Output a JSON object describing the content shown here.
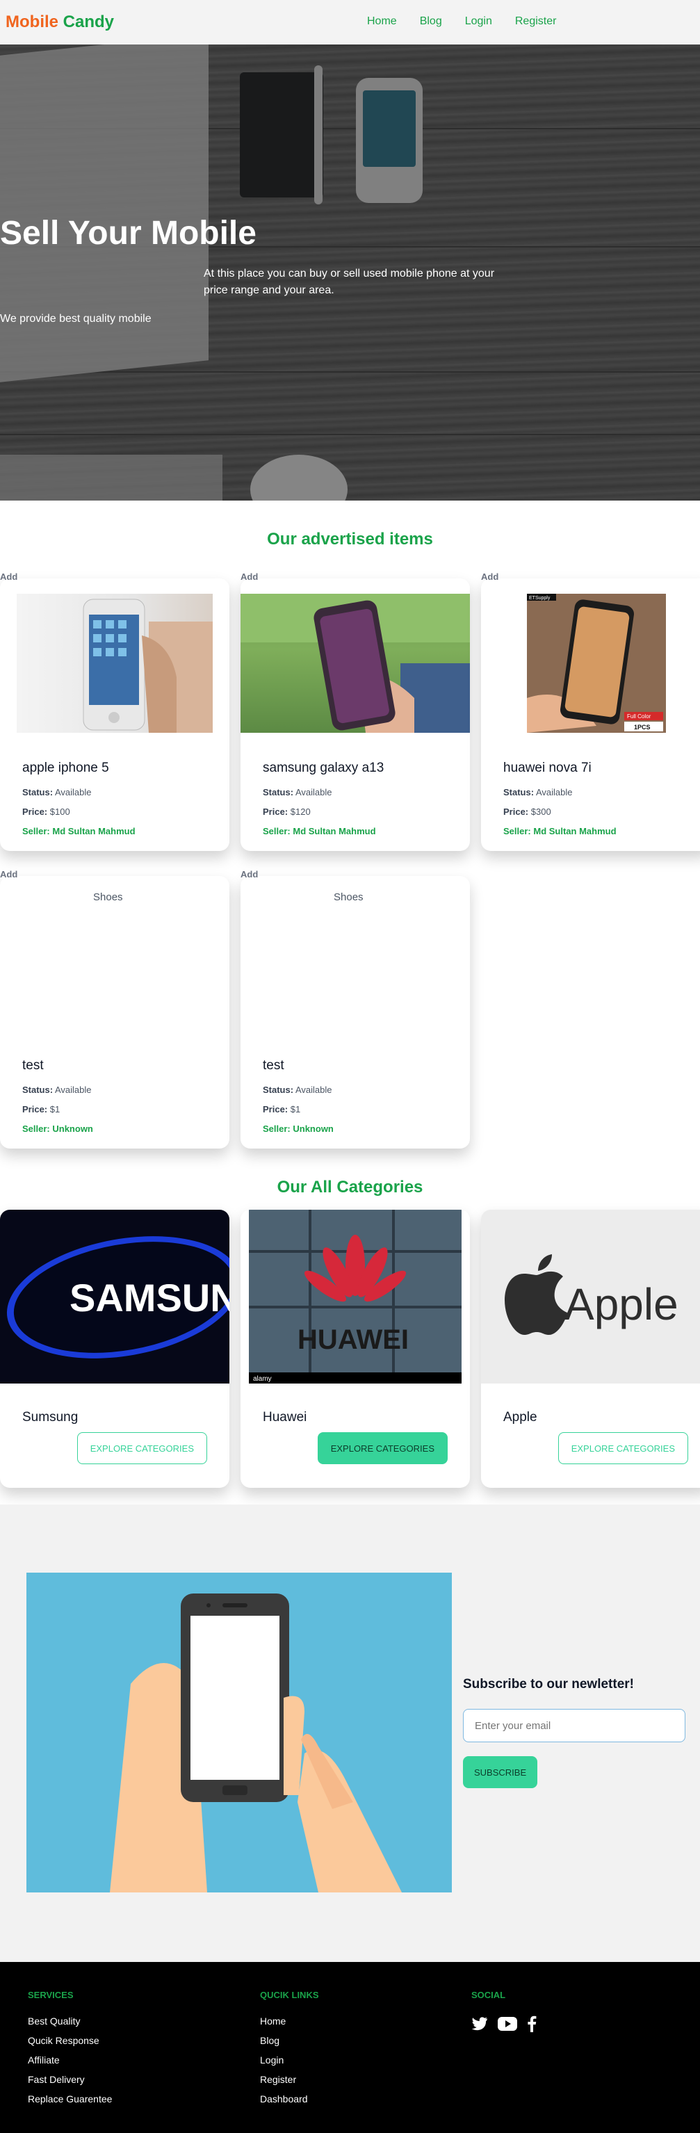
{
  "navbar": {
    "logo_part1": "Mobile",
    "logo_part2": "Candy",
    "links": [
      "Home",
      "Blog",
      "Login",
      "Register"
    ]
  },
  "hero": {
    "title": "Sell Your Mobile",
    "description": "At this place you can buy or sell used mobile phone at your price range and your area.",
    "subtext": "We provide best quality mobile"
  },
  "advertised": {
    "title": "Our advertised items",
    "badge": "Add",
    "status_label": "Status:",
    "price_label": "Price:",
    "seller_label": "Seller:",
    "items": [
      {
        "name": "apple iphone 5",
        "status": "Available",
        "price": "$100",
        "seller": "Md Sultan Mahmud",
        "image": "iphone"
      },
      {
        "name": "samsung galaxy a13",
        "status": "Available",
        "price": "$120",
        "seller": "Md Sultan Mahmud",
        "image": "samsung"
      },
      {
        "name": "huawei nova 7i",
        "status": "Available",
        "price": "$300",
        "seller": "Md Sultan Mahmud",
        "image": "huawei"
      },
      {
        "name": "test",
        "status": "Available",
        "price": "$1",
        "seller": "Unknown",
        "image_alt": "Shoes"
      },
      {
        "name": "test",
        "status": "Available",
        "price": "$1",
        "seller": "Unknown",
        "image_alt": "Shoes"
      }
    ],
    "huawei_img_text": {
      "top": "ETSupply",
      "bottom_red": "Full Color",
      "bottom": "1PCS"
    }
  },
  "categories": {
    "title": "Our All Categories",
    "items": [
      {
        "name": "Sumsung",
        "button": "EXPLORE CATEGORIES",
        "style": "outline",
        "logo_text": "SAMSUNG"
      },
      {
        "name": "Huawei",
        "button": "EXPLORE CATEGORIES",
        "style": "filled",
        "logo_text": "HUAWEI",
        "watermark": "alamy"
      },
      {
        "name": "Apple",
        "button": "EXPLORE CATEGORIES",
        "style": "outline",
        "logo_text": "Apple"
      }
    ]
  },
  "newsletter": {
    "title": "Subscribe to our newletter!",
    "placeholder": "Enter your email",
    "button": "SUBSCRIBE"
  },
  "footer": {
    "services": {
      "title": "SERVICES",
      "items": [
        "Best Quality",
        "Qucik Response",
        "Affiliate",
        "Fast Delivery",
        "Replace Guarentee"
      ]
    },
    "quick_links": {
      "title": "QUCIK LINKS",
      "items": [
        "Home",
        "Blog",
        "Login",
        "Register",
        "Dashboard"
      ]
    },
    "social": {
      "title": "SOCIAL",
      "icons": [
        "twitter-icon",
        "youtube-icon",
        "facebook-icon"
      ]
    }
  },
  "colors": {
    "brand_orange": "#f0641e",
    "brand_green": "#1aa34a",
    "accent": "#36d399",
    "footer_bg": "#000000"
  }
}
